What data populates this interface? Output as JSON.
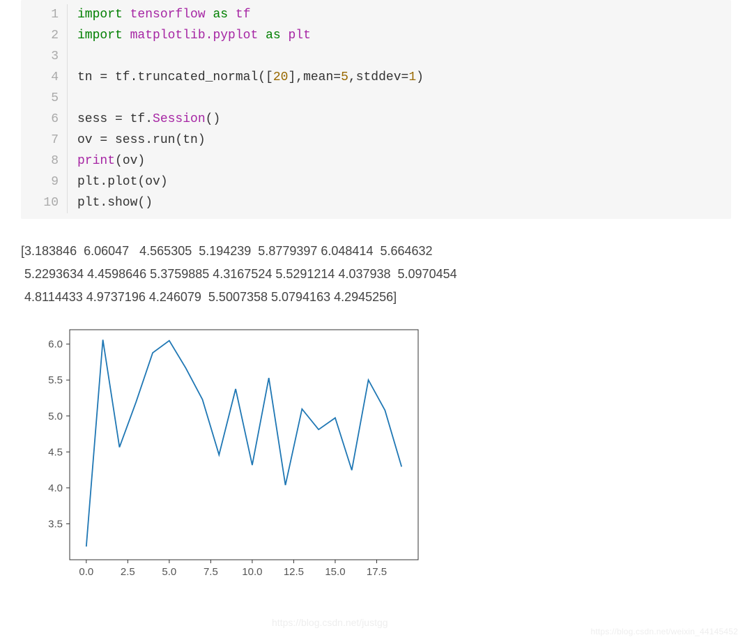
{
  "code": {
    "lines": [
      {
        "n": "1",
        "seg": [
          [
            "kw",
            "import"
          ],
          [
            "",
            " "
          ],
          [
            "mod",
            "tensorflow"
          ],
          [
            "",
            " "
          ],
          [
            "kw",
            "as"
          ],
          [
            "",
            " "
          ],
          [
            "mod",
            "tf"
          ]
        ]
      },
      {
        "n": "2",
        "seg": [
          [
            "kw",
            "import"
          ],
          [
            "",
            " "
          ],
          [
            "mod",
            "matplotlib.pyplot"
          ],
          [
            "",
            " "
          ],
          [
            "kw",
            "as"
          ],
          [
            "",
            " "
          ],
          [
            "mod",
            "plt"
          ]
        ]
      },
      {
        "n": "3",
        "seg": [
          [
            "",
            ""
          ]
        ]
      },
      {
        "n": "4",
        "seg": [
          [
            "",
            "tn = tf.truncated_normal(["
          ],
          [
            "lit",
            "20"
          ],
          [
            "",
            "],mean="
          ],
          [
            "lit",
            "5"
          ],
          [
            "",
            ",stddev="
          ],
          [
            "lit",
            "1"
          ],
          [
            "",
            ")"
          ]
        ]
      },
      {
        "n": "5",
        "seg": [
          [
            "",
            ""
          ]
        ]
      },
      {
        "n": "6",
        "seg": [
          [
            "",
            "sess = tf."
          ],
          [
            "fn",
            "Session"
          ],
          [
            "",
            "()"
          ]
        ]
      },
      {
        "n": "7",
        "seg": [
          [
            "",
            "ov = sess.run(tn)"
          ]
        ]
      },
      {
        "n": "8",
        "seg": [
          [
            "fn",
            "print"
          ],
          [
            "",
            "(ov)"
          ]
        ]
      },
      {
        "n": "9",
        "seg": [
          [
            "",
            "plt.plot(ov)"
          ]
        ]
      },
      {
        "n": "10",
        "seg": [
          [
            "",
            "plt.show()"
          ]
        ]
      }
    ]
  },
  "output_text": "[3.183846  6.06047   4.565305  5.194239  5.8779397 6.048414  5.664632\n 5.2293634 4.4598646 5.3759885 4.3167524 5.5291214 4.037938  5.0970454\n 4.8114433 4.9737196 4.246079  5.5007358 5.0794163 4.2945256]",
  "chart_data": {
    "type": "line",
    "x": [
      0,
      1,
      2,
      3,
      4,
      5,
      6,
      7,
      8,
      9,
      10,
      11,
      12,
      13,
      14,
      15,
      16,
      17,
      18,
      19
    ],
    "values": [
      3.183846,
      6.06047,
      4.565305,
      5.194239,
      5.8779397,
      6.048414,
      5.664632,
      5.2293634,
      4.4598646,
      5.3759885,
      4.3167524,
      5.5291214,
      4.037938,
      5.0970454,
      4.8114433,
      4.9737196,
      4.246079,
      5.5007358,
      5.0794163,
      4.2945256
    ],
    "xticks": [
      0.0,
      2.5,
      5.0,
      7.5,
      10.0,
      12.5,
      15.0,
      17.5
    ],
    "yticks": [
      3.5,
      4.0,
      4.5,
      5.0,
      5.5,
      6.0
    ],
    "xlim": [
      -1,
      20
    ],
    "ylim": [
      3.0,
      6.2
    ],
    "line_color": "#1f77b4"
  },
  "watermark_right": "https://blog.csdn.net/weixin_44145452",
  "watermark_mid": "https://blog.csdn.net/justgg"
}
